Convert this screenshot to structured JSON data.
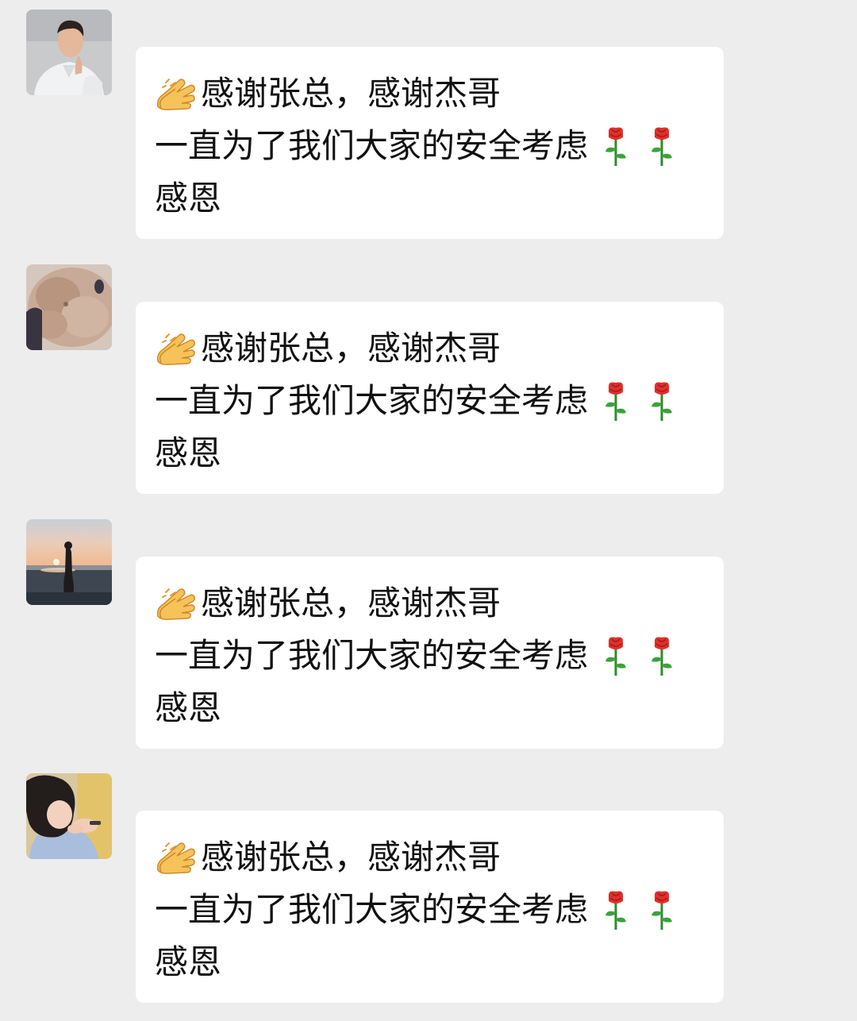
{
  "theme": {
    "background": "#ededed",
    "bubble_background": "#ffffff",
    "text_color": "#111111"
  },
  "messages": [
    {
      "avatar": "man-in-white-shirt-avatar",
      "emoji_lead": "clapping-hand-icon",
      "line1": "感谢张总，感谢杰哥",
      "line2": "一直为了我们大家的安全考虑",
      "line2_emojis": [
        "rose-icon",
        "rose-icon"
      ],
      "line3": "感恩"
    },
    {
      "avatar": "fluffy-dog-avatar",
      "emoji_lead": "clapping-hand-icon",
      "line1": "感谢张总，感谢杰哥",
      "line2": "一直为了我们大家的安全考虑",
      "line2_emojis": [
        "rose-icon",
        "rose-icon"
      ],
      "line3": "感恩"
    },
    {
      "avatar": "sunset-beach-avatar",
      "emoji_lead": "clapping-hand-icon",
      "line1": "感谢张总，感谢杰哥",
      "line2": "一直为了我们大家的安全考虑",
      "line2_emojis": [
        "rose-icon",
        "rose-icon"
      ],
      "line3": "感恩"
    },
    {
      "avatar": "girl-with-curly-hair-avatar",
      "emoji_lead": "clapping-hand-icon",
      "line1": "感谢张总，感谢杰哥",
      "line2": "一直为了我们大家的安全考虑",
      "line2_emojis": [
        "rose-icon",
        "rose-icon"
      ],
      "line3": "感恩"
    }
  ]
}
